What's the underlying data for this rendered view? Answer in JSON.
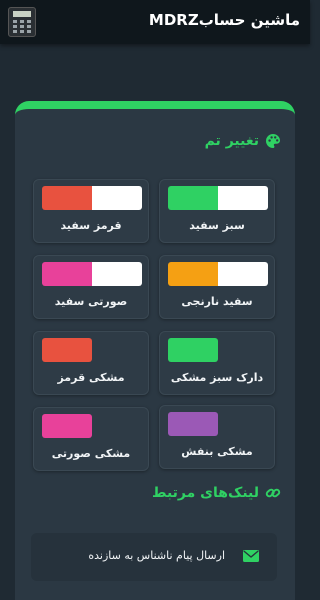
{
  "appbar": {
    "title": "ماشین حسابMDRZ"
  },
  "sections": {
    "theme_title": "تغییر تم",
    "links_title": "لینک‌های مرتبط"
  },
  "themes": [
    {
      "label": "سبز سفید",
      "colors": [
        "#2fd163",
        "#ffffff"
      ]
    },
    {
      "label": "قرمز سفید",
      "colors": [
        "#e8523f",
        "#ffffff"
      ]
    },
    {
      "label": "سفید نارنجی",
      "colors": [
        "#f5a013",
        "#ffffff"
      ]
    },
    {
      "label": "صورتی سفید",
      "colors": [
        "#e8419a",
        "#ffffff"
      ]
    },
    {
      "label": "دارک سبز مشکی",
      "colors": [
        "#2fd163"
      ]
    },
    {
      "label": "مشکی قرمز",
      "colors": [
        "#e8523f"
      ]
    },
    {
      "label": "مشکی بنفش",
      "colors": [
        "#9b59b6"
      ]
    },
    {
      "label": "مشکی صورتی",
      "colors": [
        "#e8419a"
      ]
    }
  ],
  "links": [
    {
      "label": "ارسال پیام ناشناس به سازنده",
      "icon": "envelope-icon"
    }
  ],
  "colors": {
    "accent": "#2fd163",
    "background": "#1f2a33",
    "card": "#2b3843",
    "appbar": "#0f171c"
  }
}
